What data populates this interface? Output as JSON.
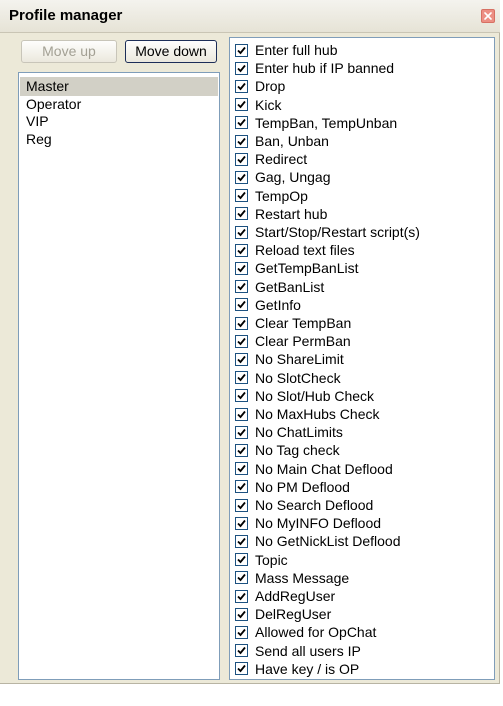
{
  "window": {
    "title": "Profile manager"
  },
  "buttons": {
    "move_up": "Move up",
    "move_down": "Move down"
  },
  "profiles": [
    {
      "label": "Master",
      "selected": true
    },
    {
      "label": "Operator",
      "selected": false
    },
    {
      "label": "VIP",
      "selected": false
    },
    {
      "label": "Reg",
      "selected": false
    }
  ],
  "permissions": [
    {
      "label": "Enter full hub",
      "checked": true
    },
    {
      "label": "Enter hub if IP banned",
      "checked": true
    },
    {
      "label": "Drop",
      "checked": true
    },
    {
      "label": "Kick",
      "checked": true
    },
    {
      "label": "TempBan, TempUnban",
      "checked": true
    },
    {
      "label": "Ban, Unban",
      "checked": true
    },
    {
      "label": "Redirect",
      "checked": true
    },
    {
      "label": "Gag, Ungag",
      "checked": true
    },
    {
      "label": "TempOp",
      "checked": true
    },
    {
      "label": "Restart hub",
      "checked": true
    },
    {
      "label": "Start/Stop/Restart script(s)",
      "checked": true
    },
    {
      "label": "Reload text files",
      "checked": true
    },
    {
      "label": "GetTempBanList",
      "checked": true
    },
    {
      "label": "GetBanList",
      "checked": true
    },
    {
      "label": "GetInfo",
      "checked": true
    },
    {
      "label": "Clear TempBan",
      "checked": true
    },
    {
      "label": "Clear PermBan",
      "checked": true
    },
    {
      "label": "No ShareLimit",
      "checked": true
    },
    {
      "label": "No SlotCheck",
      "checked": true
    },
    {
      "label": "No Slot/Hub Check",
      "checked": true
    },
    {
      "label": "No MaxHubs Check",
      "checked": true
    },
    {
      "label": "No ChatLimits",
      "checked": true
    },
    {
      "label": "No Tag check",
      "checked": true
    },
    {
      "label": "No Main Chat Deflood",
      "checked": true
    },
    {
      "label": "No PM Deflood",
      "checked": true
    },
    {
      "label": "No Search Deflood",
      "checked": true
    },
    {
      "label": "No MyINFO Deflood",
      "checked": true
    },
    {
      "label": "No GetNickList Deflood",
      "checked": true
    },
    {
      "label": "Topic",
      "checked": true
    },
    {
      "label": "Mass Message",
      "checked": true
    },
    {
      "label": "AddRegUser",
      "checked": true
    },
    {
      "label": "DelRegUser",
      "checked": true
    },
    {
      "label": "Allowed for OpChat",
      "checked": true
    },
    {
      "label": "Send all users IP",
      "checked": true
    },
    {
      "label": "Have key / is OP",
      "checked": true
    }
  ],
  "icons": {
    "close": "close-icon",
    "check": "checkmark-icon"
  },
  "colors": {
    "selection": "#d2d0c6",
    "close_button": "#ec8f84",
    "window_bg": "#ece9d8"
  }
}
